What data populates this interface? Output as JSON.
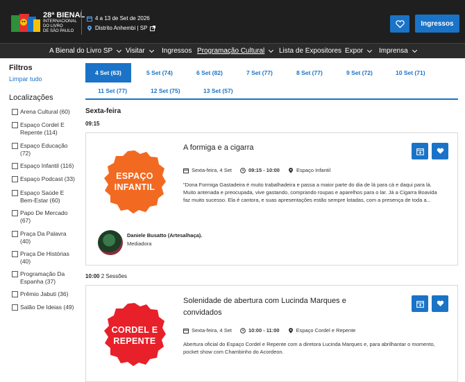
{
  "header": {
    "logo_lines": [
      "28ª BIENAL",
      "INTERNACIONAL",
      "DO LIVRO",
      "DE SÃO PAULO"
    ],
    "dates": "4 a 13 de Set de 2026",
    "venue": "Distrito Anhembi | SP",
    "favorites_icon": "heart-icon",
    "tickets_label": "Ingressos"
  },
  "nav": {
    "items": [
      "A Bienal do Livro SP",
      "Visitar",
      "Ingressos",
      "Programação Cultural",
      "Lista de Expositores",
      "Expor",
      "Imprensa"
    ],
    "active": "Programação Cultural"
  },
  "filters": {
    "title": "Filtros",
    "clear": "Limpar tudo",
    "locations_title": "Localizações",
    "locations": [
      {
        "lines": [
          "Arena Cultural (60)"
        ]
      },
      {
        "lines": [
          "Espaço Cordel E",
          "Repente (114)"
        ]
      },
      {
        "lines": [
          "Espaço Educação",
          "(72)"
        ]
      },
      {
        "lines": [
          "Espaço Infantil (116)"
        ]
      },
      {
        "lines": [
          "Espaço Podcast (33)"
        ]
      },
      {
        "lines": [
          "Espaço Saúde E",
          "Bem-Estar (60)"
        ]
      },
      {
        "lines": [
          "Papo De Mercado",
          "(67)"
        ]
      },
      {
        "lines": [
          "Praça Da Palavra",
          "(40)"
        ]
      },
      {
        "lines": [
          "Praça De Histórias",
          "(40)"
        ]
      },
      {
        "lines": [
          "Programação Da",
          "Espanha (37)"
        ]
      },
      {
        "lines": [
          "Prêmio Jabuti (36)"
        ]
      },
      {
        "lines": [
          "Salão De Ideias (49)"
        ]
      }
    ]
  },
  "days": [
    {
      "label": "4 Set (63)",
      "active": true
    },
    {
      "label": "5 Set (74)",
      "active": false
    },
    {
      "label": "6 Set (82)",
      "active": false
    },
    {
      "label": "7 Set (77)",
      "active": false
    },
    {
      "label": "8 Set (77)",
      "active": false
    },
    {
      "label": "9 Set (72)",
      "active": false
    },
    {
      "label": "10 Set (71)",
      "active": false
    },
    {
      "label": "11 Set (77)",
      "active": false
    },
    {
      "label": "12 Set (75)",
      "active": false
    },
    {
      "label": "13 Set (57)",
      "active": false
    }
  ],
  "schedule": {
    "day_heading": "Sexta-feira",
    "slots": [
      {
        "time": "09:15",
        "sessions": "",
        "event": {
          "title_lines": [
            "A formiga e a cigarra"
          ],
          "badge_lines": [
            "ESPAÇO",
            "INFANTIL"
          ],
          "badge_color": "#f26a21",
          "date": "Sexta-feira, 4 Set",
          "hours": "09:15 - 10:00",
          "place": "Espaço Infantil",
          "description_lines": [
            "\"Dona Formiga Gastadeira é muito trabalhadeira e passa a maior parte do dia de lá para cá e daqui para lá.",
            "Muito antenada e preocupada, vive gastando, comprando roupas e aparelhos para o lar. Já a Cigarra Boavida",
            "faz muito sucesso. Ela é cantora, e suas apresentações estão sempre lotadas, com a presença de toda a..."
          ],
          "speaker": {
            "name": "Daniele Busatto (Artesalhaça).",
            "role": "Mediadora"
          }
        }
      },
      {
        "time": "10:00",
        "sessions": "2 Sessões",
        "event": {
          "title_lines": [
            "Solenidade de abertura com Lucinda Marques e",
            "convidados"
          ],
          "badge_lines": [
            "CORDEL E",
            "REPENTE"
          ],
          "badge_color": "#e8202a",
          "date": "Sexta-feira, 4 Set",
          "hours": "10:00 - 11:00",
          "place": "Espaço Cordel e Repente",
          "description_lines": [
            "Abertura oficial do Espaço Cordel e Repente com a diretora Lucinda Marques e, para abrilhantar o momento,",
            "pocket show com Chambinho do Acordeon."
          ]
        }
      }
    ]
  },
  "icons": {
    "calendar": "calendar-icon",
    "clock": "clock-icon",
    "pin": "location-pin-icon",
    "add_agenda": "calendar-add-icon",
    "favorite": "heart-icon"
  },
  "colors": {
    "accent": "#1a73c7",
    "topbar": "#1f1f1f",
    "nav": "#2b2b2b"
  }
}
